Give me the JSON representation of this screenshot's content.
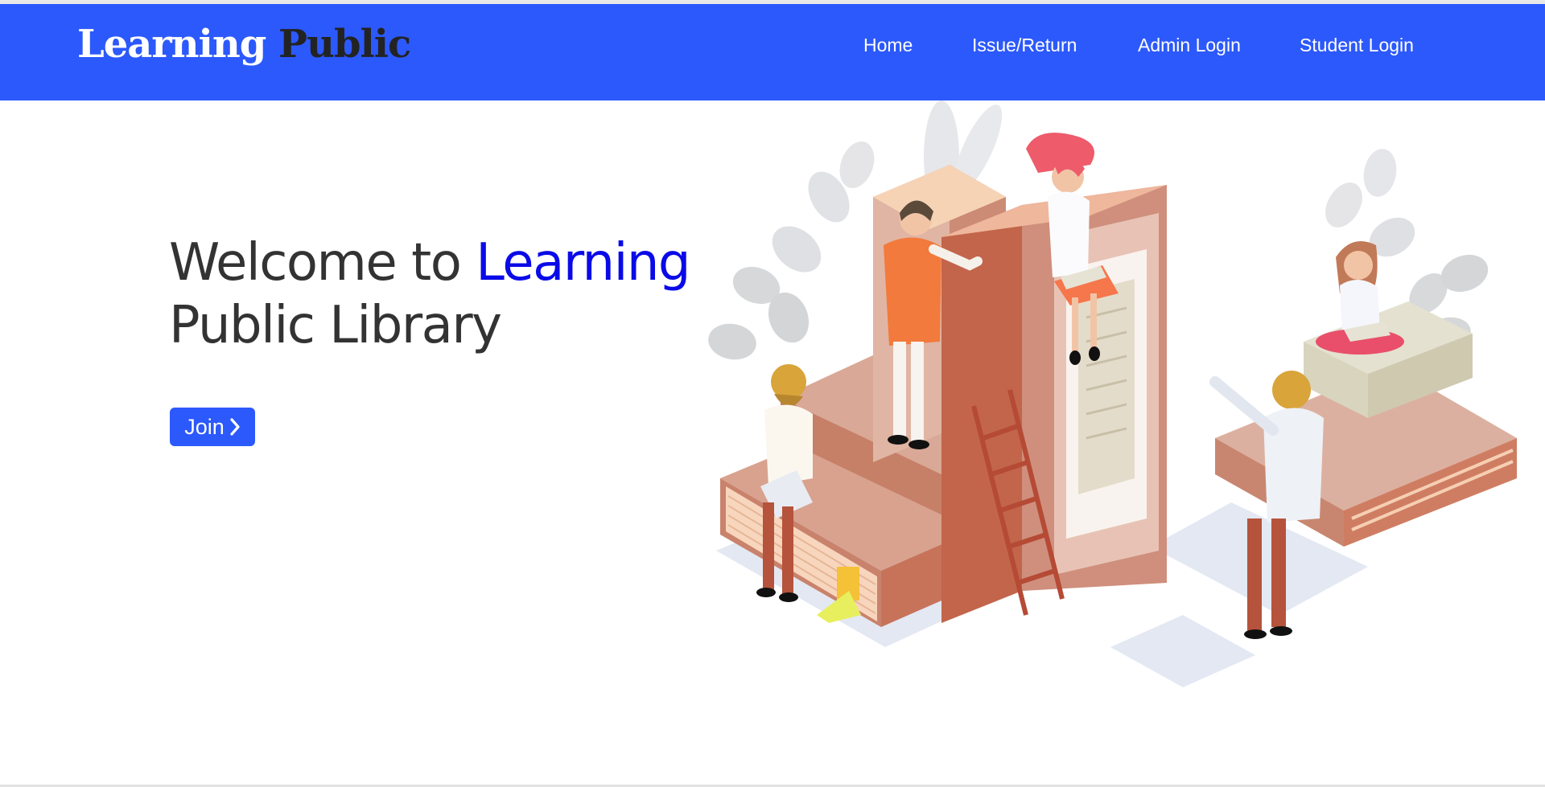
{
  "brand": {
    "word1": "Learning",
    "word2": "Public"
  },
  "nav": {
    "items": [
      {
        "label": "Home"
      },
      {
        "label": "Issue/Return"
      },
      {
        "label": "Admin Login"
      },
      {
        "label": "Student Login"
      }
    ]
  },
  "hero": {
    "title_prefix": "Welcome to ",
    "title_accent": "Learning",
    "title_line2": "Public Library",
    "join_label": "Join",
    "join_icon": "chevron-right-icon"
  },
  "colors": {
    "brand_blue": "#2c59fb",
    "accent_blue": "#0a0ae8",
    "heading": "#333333"
  }
}
